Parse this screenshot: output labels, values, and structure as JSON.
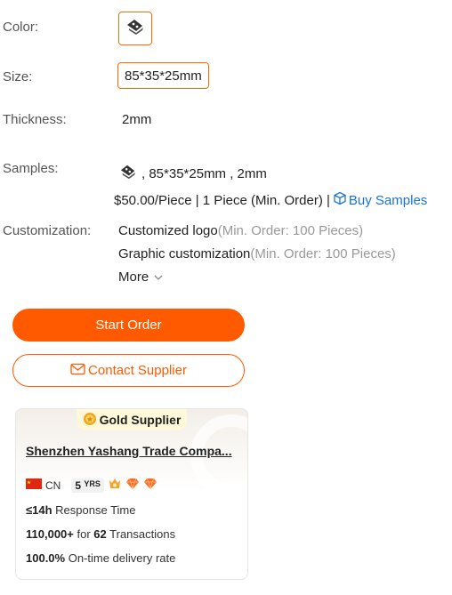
{
  "color": {
    "label": "Color:",
    "swatch_icon": "bracket-icon"
  },
  "size": {
    "label": "Size:",
    "value": "85*35*25mm"
  },
  "thickness": {
    "label": "Thickness:",
    "value": "2mm"
  },
  "samples": {
    "label": "Samples:",
    "spec": ", 85*35*25mm , 2mm",
    "price": "$50.00/Piece | 1 Piece (Min. Order) |",
    "buy_label": "Buy Samples"
  },
  "customization": {
    "label": "Customization:",
    "items": [
      {
        "name": "Customized logo",
        "moq": "(Min. Order: 100 Pieces)"
      },
      {
        "name": "Graphic customization",
        "moq": "(Min. Order: 100 Pieces)"
      }
    ],
    "more_label": "More"
  },
  "actions": {
    "start_order": "Start Order",
    "contact_supplier": "Contact Supplier"
  },
  "supplier": {
    "badge": "Gold Supplier",
    "name": "Shenzhen Yashang Trade Compa...",
    "country": "CN",
    "years": "5",
    "years_unit": "YRS",
    "response_value": "≤14h",
    "response_label": "Response Time",
    "transactions_value": "110,000+",
    "transactions_for": "for",
    "transactions_count": "62",
    "transactions_label": "Transactions",
    "ontime_value": "100.0%",
    "ontime_label": "On-time delivery rate"
  },
  "colors": {
    "accent": "#ff5a00",
    "link": "#1a73d9"
  }
}
